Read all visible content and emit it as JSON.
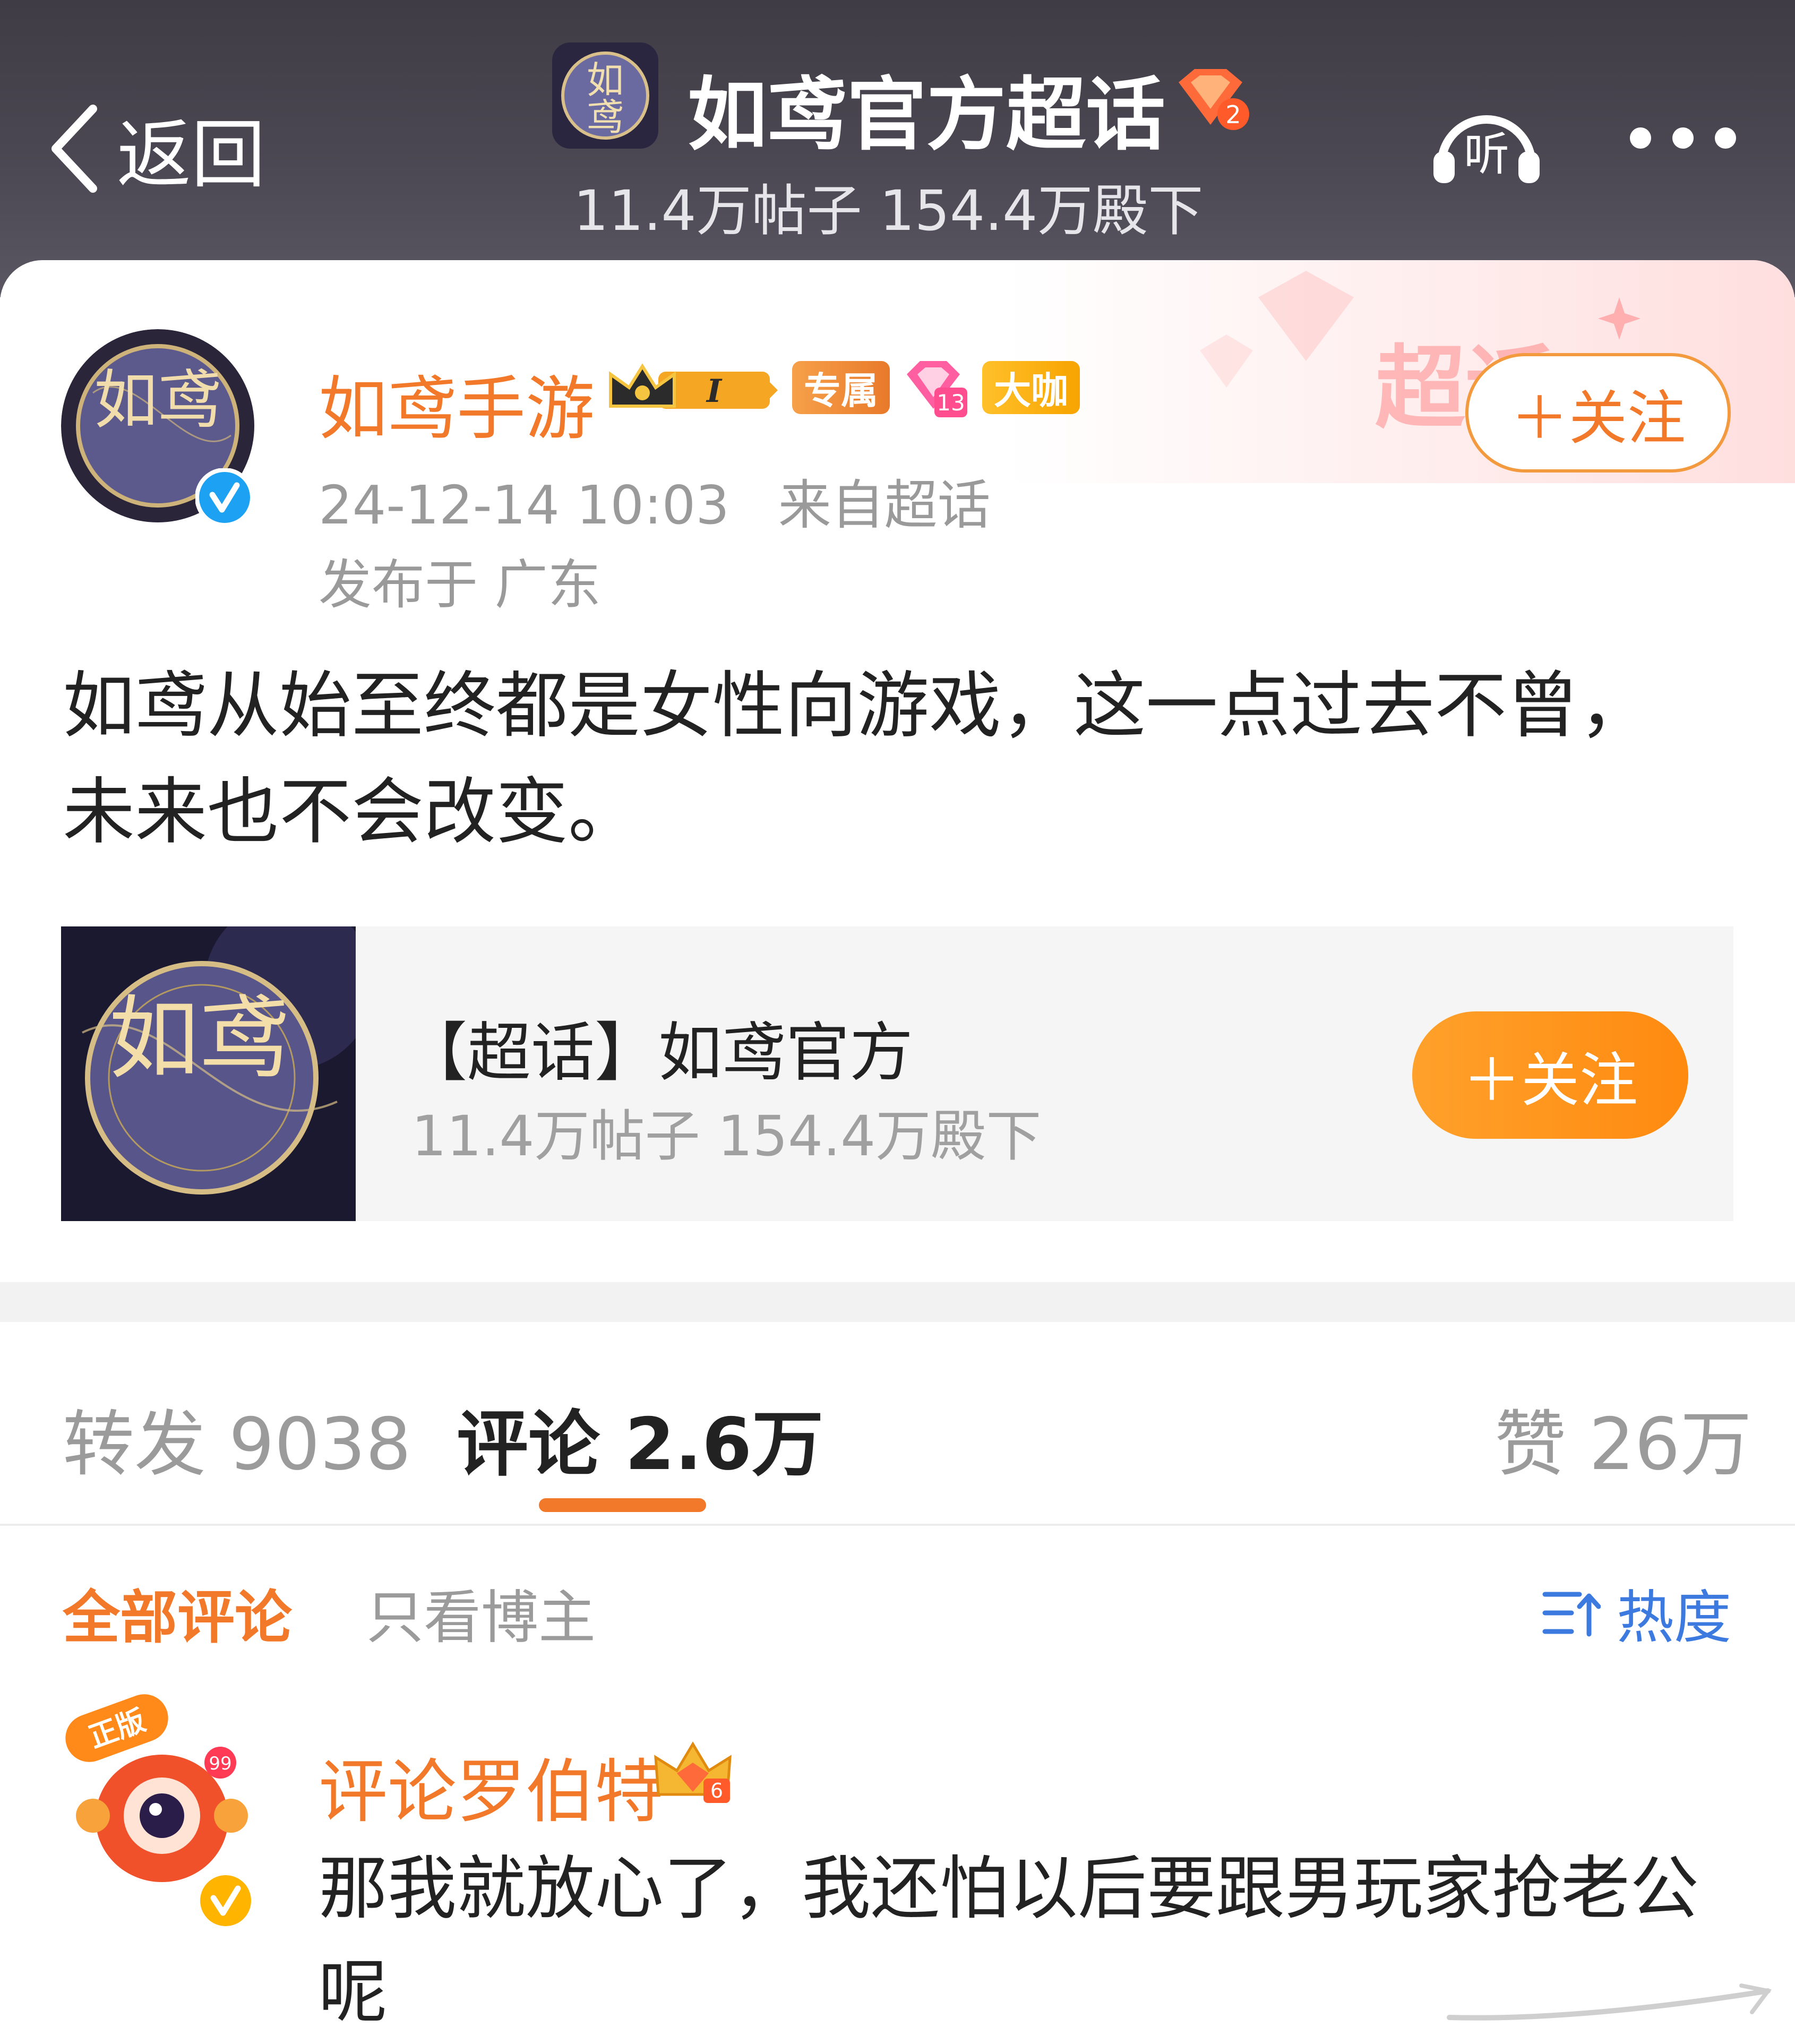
{
  "header": {
    "back_label": "返回",
    "topic_title": "如鸢官方超话",
    "topic_level": "2",
    "topic_stats": "11.4万帖子 154.4万殿下",
    "listen_label": "听"
  },
  "post": {
    "author": "如鸢手游",
    "badges": {
      "rank": "I",
      "exclusive": "专属",
      "level": "13",
      "vip": "大咖"
    },
    "time": "24-12-14 10:03",
    "source": "来自超话",
    "location": "发布于 广东",
    "follow_label": "＋关注",
    "text": "如鸢从始至终都是女性向游戏，这一点过去不曾，未来也不会改变。",
    "deco_text": "超话",
    "avatar_text": "如鸢"
  },
  "topic_card": {
    "title": "【超话】如鸢官方",
    "stats": "11.4万帖子 154.4万殿下",
    "follow_label": "＋关注"
  },
  "tabs": {
    "repost": "转发 9038",
    "comment": "评论 2.6万",
    "like": "赞 26万"
  },
  "filters": {
    "all": "全部评论",
    "author_only": "只看博主",
    "sort": "热度"
  },
  "comment": {
    "user": "评论罗伯特",
    "badge_level": "6",
    "avatar_tag": "正版",
    "avatar_count": "99",
    "text": "那我就放心了，我还怕以后要跟男玩家抢老公呢"
  },
  "colors": {
    "accent": "#f2782a",
    "blue": "#3c7ae0",
    "verified": "#1da1f2",
    "header_bg": "#46434d"
  }
}
